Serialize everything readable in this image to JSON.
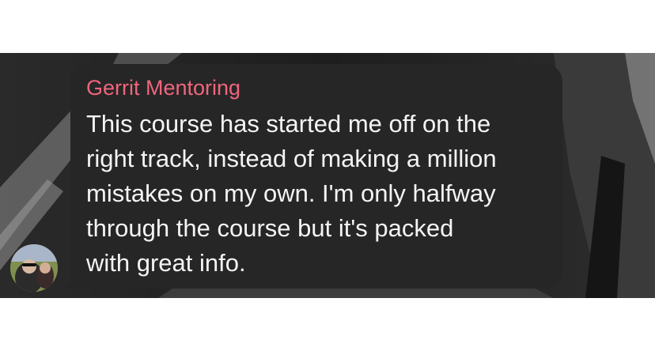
{
  "comment": {
    "sender_name": "Gerrit Mentoring",
    "text": "This course has started me off on the\nright track, instead of making a million\nmistakes on my own. I'm only halfway\nthrough the course but it's packed\nwith great info."
  },
  "colors": {
    "sender_name": "#f0657d",
    "bubble": "#262626",
    "message_text": "#f4f4f4",
    "background": "#1c1c1c"
  },
  "icons": {
    "avatar": "user-avatar-photo"
  }
}
